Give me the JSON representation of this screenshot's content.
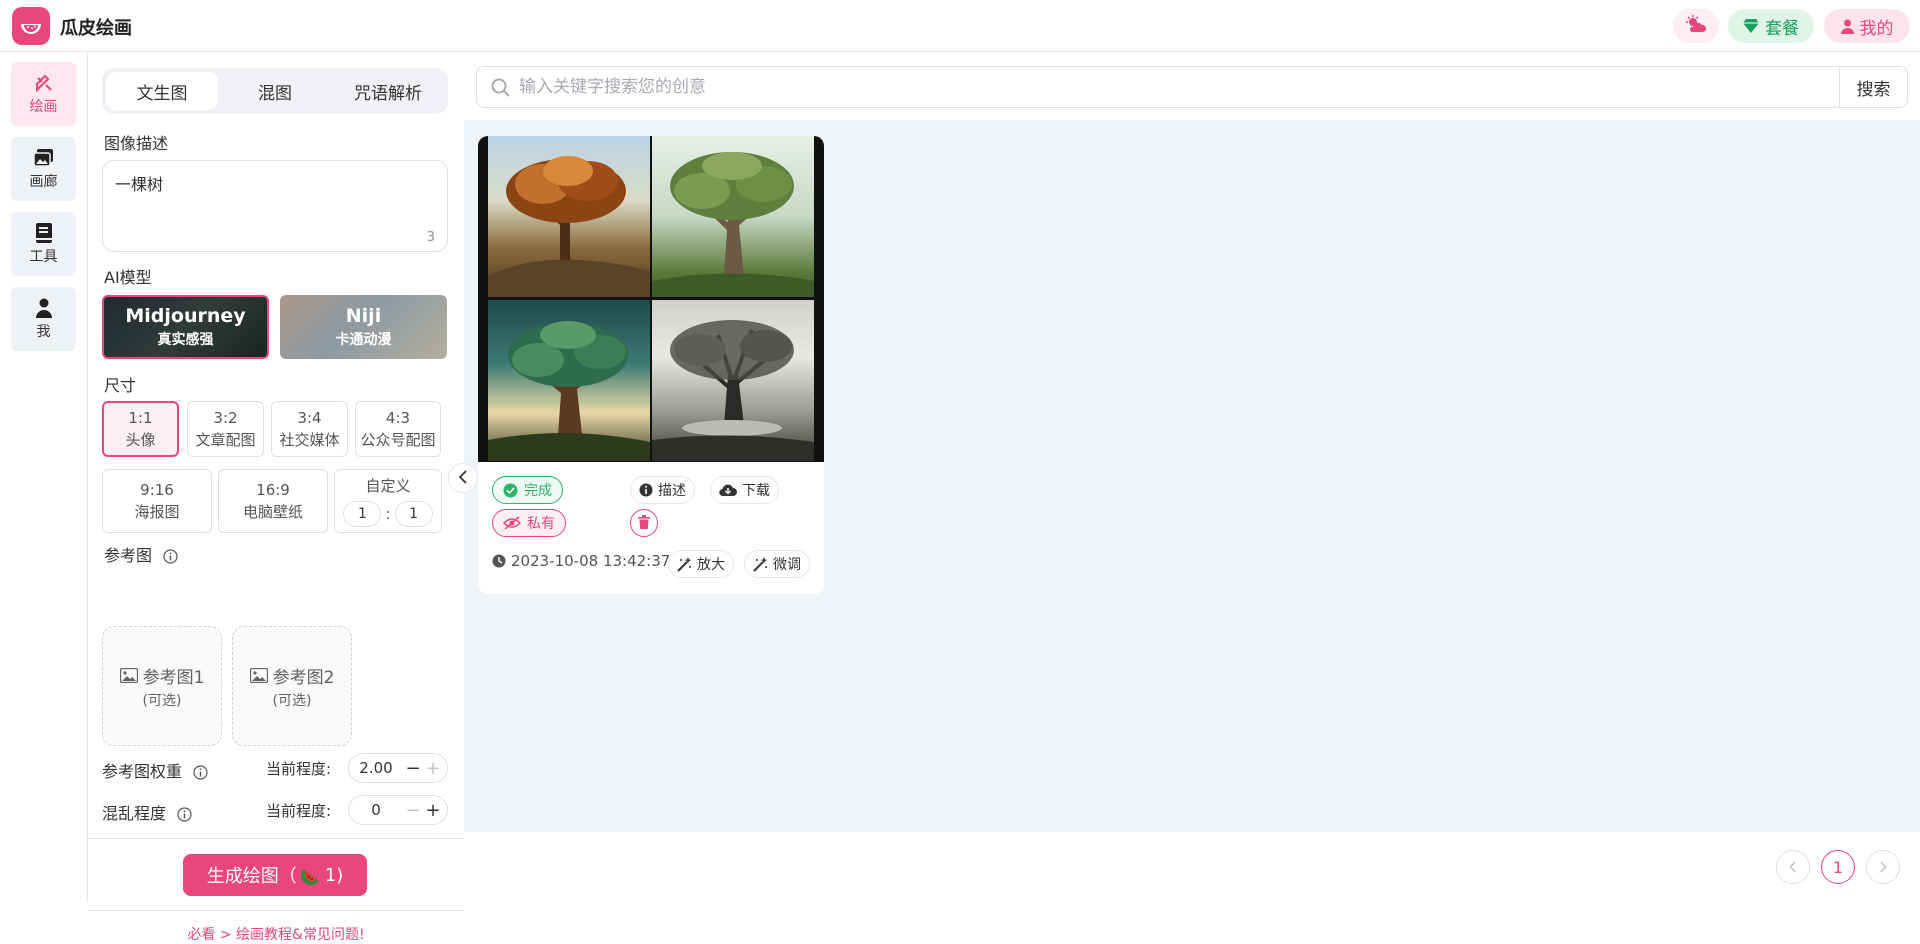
{
  "app": {
    "title": "瓜皮绘画",
    "logo_icon": "watermelon-logo-icon"
  },
  "header": {
    "weather_icon": "weather-icon",
    "plan_label": "套餐",
    "mine_label": "我的"
  },
  "sidebar": {
    "items": [
      {
        "label": "绘画",
        "icon": "paint-brush-icon",
        "active": true
      },
      {
        "label": "画廊",
        "icon": "gallery-icon",
        "active": false
      },
      {
        "label": "工具",
        "icon": "book-icon",
        "active": false
      },
      {
        "label": "我",
        "icon": "user-icon",
        "active": false
      }
    ]
  },
  "panel": {
    "tabs": [
      "文生图",
      "混图",
      "咒语解析"
    ],
    "active_tab": "文生图",
    "prompt_label": "图像描述",
    "prompt_value": "一棵树",
    "prompt_count": "3",
    "model_label": "AI模型",
    "models": [
      {
        "name": "Midjourney",
        "desc": "真实感强",
        "selected": true
      },
      {
        "name": "Niji",
        "desc": "卡通动漫",
        "selected": false
      }
    ],
    "size_label": "尺寸",
    "sizes_row1": [
      {
        "ratio": "1:1",
        "name": "头像",
        "selected": true
      },
      {
        "ratio": "3:2",
        "name": "文章配图"
      },
      {
        "ratio": "3:4",
        "name": "社交媒体"
      },
      {
        "ratio": "4:3",
        "name": "公众号配图"
      }
    ],
    "sizes_row2": [
      {
        "ratio": "9:16",
        "name": "海报图"
      },
      {
        "ratio": "16:9",
        "name": "电脑壁纸"
      }
    ],
    "custom": {
      "label": "自定义",
      "w": "1",
      "sep": ":",
      "h": "1"
    },
    "ref_label": "参考图",
    "refs": [
      {
        "label": "参考图1",
        "opt": "(可选)"
      },
      {
        "label": "参考图2",
        "opt": "(可选)"
      }
    ],
    "ref_weight_label": "参考图权重",
    "chaos_label": "混乱程度",
    "current_level_label": "当前程度:",
    "ref_weight_value": "2.00",
    "chaos_value": "0",
    "generate_label": "生成绘图（",
    "generate_cost": "1)",
    "tip": "必看 > 绘画教程&常见问题!"
  },
  "search": {
    "placeholder": "输入关键字搜索您的创意",
    "button": "搜索"
  },
  "result": {
    "status": "完成",
    "privacy": "私有",
    "describe": "描述",
    "download": "下载",
    "upscale": "放大",
    "tweak": "微调",
    "timestamp": "2023-10-08 13:42:37"
  },
  "pagination": {
    "current": "1"
  },
  "colors": {
    "accent": "#e8467c",
    "success": "#2fb36b",
    "content_bg": "#f0f3f7"
  }
}
